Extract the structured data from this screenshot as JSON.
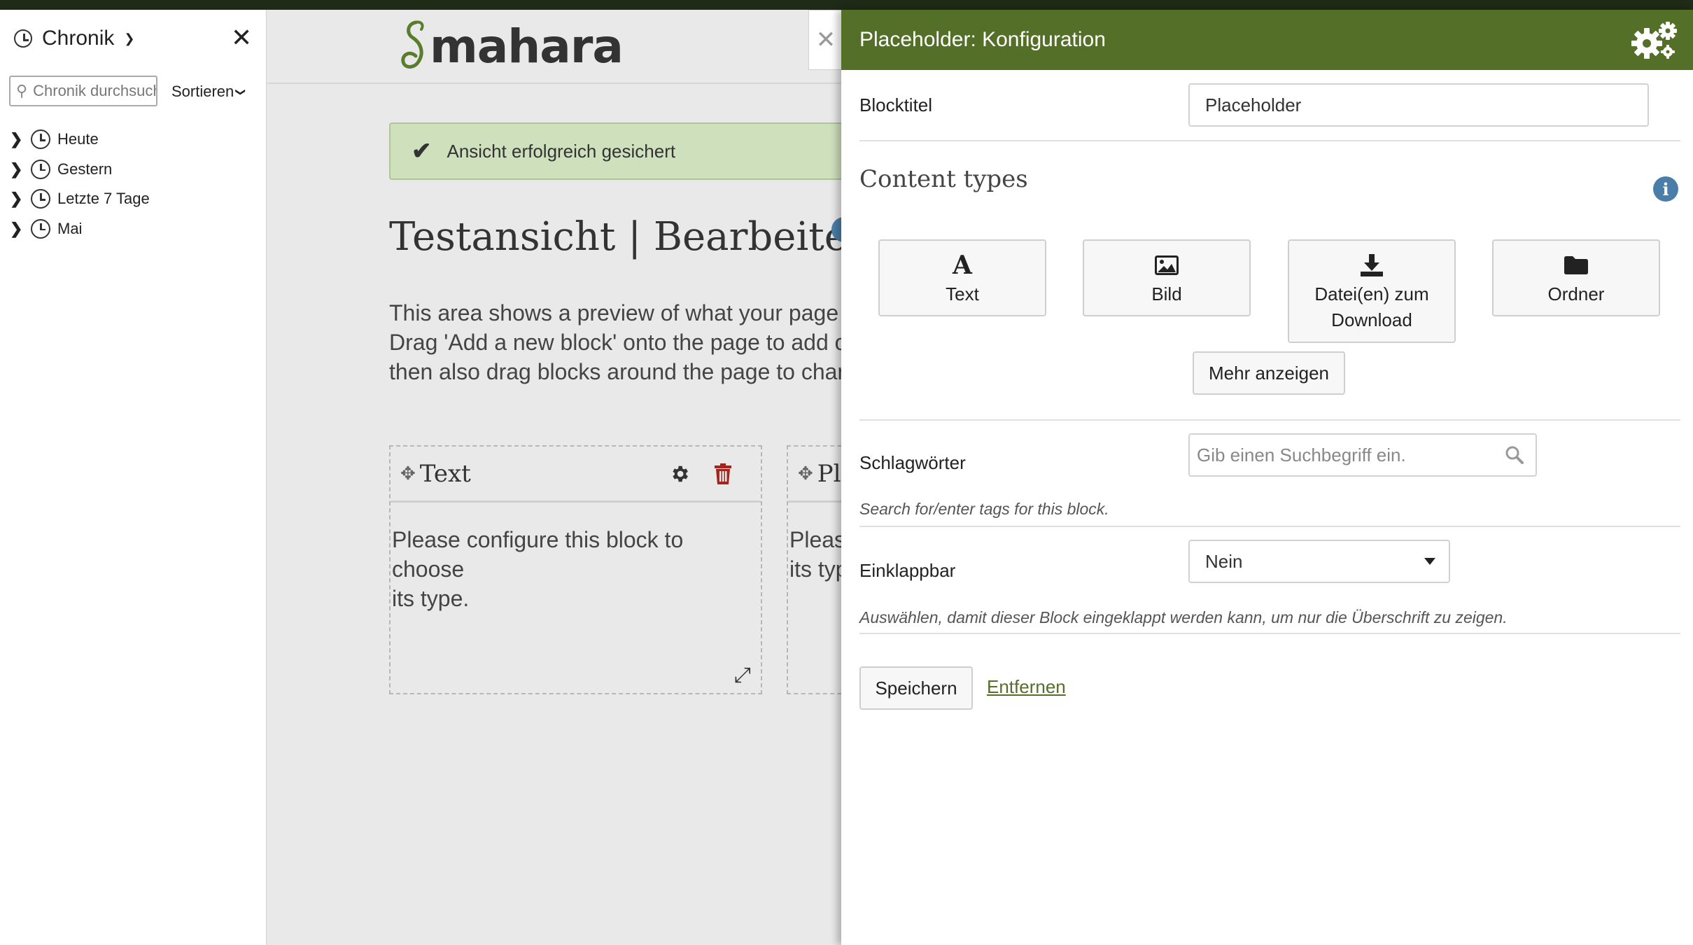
{
  "history_sidebar": {
    "title": "Chronik",
    "search_placeholder": "Chronik durchsuchen",
    "sort_label": "Sortieren",
    "items": [
      {
        "label": "Heute"
      },
      {
        "label": "Gestern"
      },
      {
        "label": "Letzte 7 Tage"
      },
      {
        "label": "Mai"
      }
    ]
  },
  "page": {
    "logo_text": "mahara",
    "alert_text": "Ansicht erfolgreich gesichert",
    "title": "Testansicht | Bearbeiten",
    "intro_lines": [
      "This area shows a preview of what your page looks",
      "Drag 'Add a new block' onto the page to add one",
      "then also drag blocks around the page to change"
    ],
    "blocks": [
      {
        "title": "Text",
        "body_line1": "Please configure this block to choose",
        "body_line2": "its type."
      },
      {
        "title": "Pla",
        "body_line1": "Please",
        "body_line2": "its typ"
      }
    ]
  },
  "panel": {
    "header_title": "Placeholder: Konfiguration",
    "block_title_label": "Blocktitel",
    "block_title_value": "Placeholder",
    "content_types_heading": "Content types",
    "content_types": [
      {
        "label": "Text",
        "icon": "text-font-icon"
      },
      {
        "label": "Bild",
        "icon": "image-icon"
      },
      {
        "label_line1": "Datei(en) zum",
        "label_line2": "Download",
        "icon": "download-icon"
      },
      {
        "label": "Ordner",
        "icon": "folder-icon"
      }
    ],
    "more_button": "Mehr anzeigen",
    "tags_label": "Schlagwörter",
    "tags_placeholder": "Gib einen Suchbegriff ein.",
    "tags_help": "Search for/enter tags for this block.",
    "collapsible_label": "Einklappbar",
    "collapsible_value": "Nein",
    "collapsible_help": "Auswählen, damit dieser Block eingeklappt werden kann, um nur die Überschrift zu zeigen.",
    "save_button": "Speichern",
    "remove_link": "Entfernen"
  },
  "colors": {
    "panel_header": "#546f27",
    "alert_bg": "#cfe0bd",
    "info_blue": "#4a7ea8",
    "delete_red": "#a8231b"
  }
}
